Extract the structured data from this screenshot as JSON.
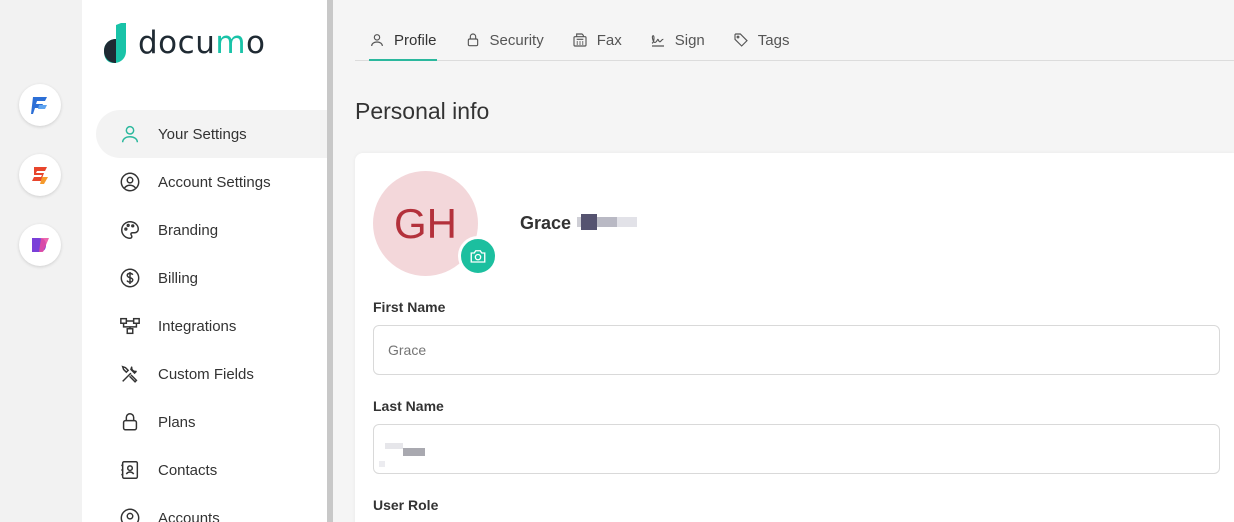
{
  "app_rail": {
    "apps": [
      {
        "name": "fax-app-icon",
        "color": "#2c6fd6"
      },
      {
        "name": "sign-app-icon",
        "color": "#e8452c"
      },
      {
        "name": "docs-app-icon",
        "color": "#7a3fd8"
      }
    ]
  },
  "brand": {
    "logo_text_before": "docu",
    "logo_text_accent": "m",
    "logo_text_after": "o",
    "accent_color": "#19c3a8"
  },
  "sidebar": {
    "items": [
      {
        "label": "Your Settings",
        "icon": "user-icon",
        "active": true
      },
      {
        "label": "Account Settings",
        "icon": "user-circle-icon"
      },
      {
        "label": "Branding",
        "icon": "palette-icon"
      },
      {
        "label": "Billing",
        "icon": "dollar-icon"
      },
      {
        "label": "Integrations",
        "icon": "integrations-icon"
      },
      {
        "label": "Custom Fields",
        "icon": "tools-icon"
      },
      {
        "label": "Plans",
        "icon": "lock-icon"
      },
      {
        "label": "Contacts",
        "icon": "contacts-icon"
      },
      {
        "label": "Accounts",
        "icon": "accounts-icon"
      }
    ]
  },
  "tabs": [
    {
      "label": "Profile",
      "icon": "user-icon",
      "active": true
    },
    {
      "label": "Security",
      "icon": "lock-icon"
    },
    {
      "label": "Fax",
      "icon": "fax-icon"
    },
    {
      "label": "Sign",
      "icon": "signature-icon"
    },
    {
      "label": "Tags",
      "icon": "tag-icon"
    }
  ],
  "main": {
    "section_title": "Personal info",
    "avatar_initials": "GH",
    "user_name": "Grace",
    "first_name_label": "First Name",
    "first_name_value": "Grace",
    "last_name_label": "Last Name",
    "last_name_value": "",
    "user_role_label": "User Role"
  }
}
